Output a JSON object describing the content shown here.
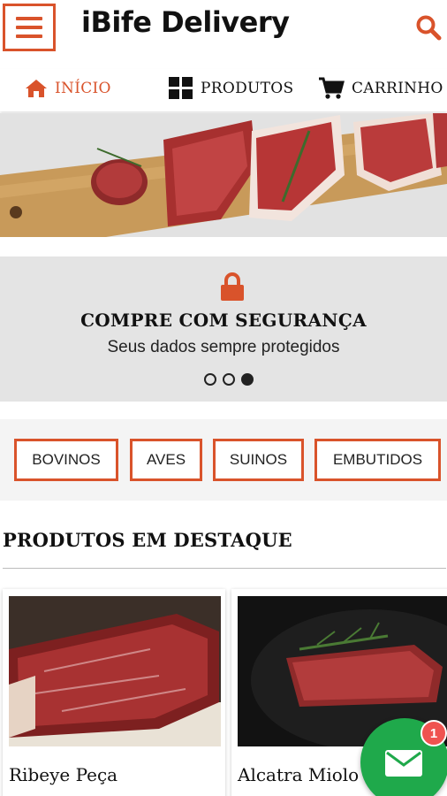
{
  "header": {
    "title": "iBife Delivery",
    "menu_icon": "hamburger-menu-icon",
    "search_icon": "search-icon"
  },
  "nav": {
    "items": [
      {
        "label": "INÍCIO",
        "icon": "home-icon",
        "active": true
      },
      {
        "label": "PRODUTOS",
        "icon": "grid-icon",
        "active": false
      },
      {
        "label": "CARRINHO",
        "icon": "cart-icon",
        "active": false
      }
    ]
  },
  "slide": {
    "icon": "lock-icon",
    "title": "COMPRE COM SEGURANÇA",
    "subtitle": "Seus dados sempre protegidos",
    "dot_count": 3,
    "active_dot": 3
  },
  "categories": [
    "BOVINOS",
    "AVES",
    "SUINOS",
    "EMBUTIDOS"
  ],
  "featured": {
    "title": "PRODUTOS EM DESTAQUE",
    "products": [
      {
        "name": "Ribeye Peça"
      },
      {
        "name": "Alcatra Miolo"
      }
    ]
  },
  "fab": {
    "icon": "mail-icon",
    "badge": "1"
  },
  "colors": {
    "accent": "#d9532b",
    "fab_green": "#1fa94b",
    "badge_red": "#ef5350"
  }
}
